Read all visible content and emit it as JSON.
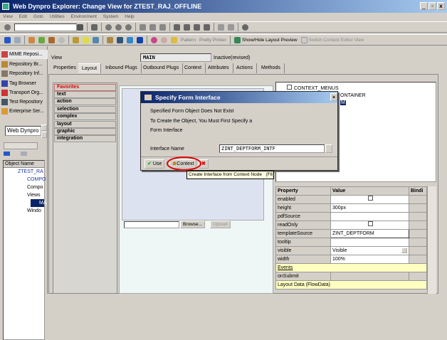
{
  "window": {
    "title": "Web Dynpro Explorer: Change View for ZTEST_RAJ_OFFLINE",
    "min": "_",
    "restore": "▫",
    "close": "x"
  },
  "menu": [
    "View",
    "Edit",
    "Goto",
    "Utilities",
    "Environment",
    "System",
    "Help"
  ],
  "toolbar2": {
    "pattern": "Pattern",
    "pretty_printer": "Pretty Printer",
    "show_hide": "Show/Hide Layout Preview",
    "switch_context": "Switch Context Editor View"
  },
  "nav": {
    "items": [
      "MIME Reposi...",
      "Repository Br...",
      "Repository Inf...",
      "Tag Browser",
      "Transport Org...",
      "Test Repository",
      "Enterprise Ser..."
    ],
    "dropdown": "Web Dynpro",
    "tree_header": "Object Name",
    "tree": [
      "ZTEST_RA",
      "COMPO",
      "Compo",
      "Views",
      "MA",
      "Windo"
    ]
  },
  "view": {
    "label": "View",
    "name": "MAIN",
    "status": "Inactive(revised)"
  },
  "tabs": [
    "Properties",
    "Layout",
    "Inbound Plugs",
    "Outbound Plugs",
    "Context",
    "Attributes",
    "Actions",
    "Methods"
  ],
  "active_tab": "Layout",
  "palette": [
    "Favorites",
    "text",
    "action",
    "selection",
    "complex",
    "layout",
    "graphic",
    "integration"
  ],
  "upload": {
    "browse": "Browse...",
    "upload": "Upload"
  },
  "ui_tree": [
    "CONTEXT_MENUS",
    "ONTAINER",
    "M"
  ],
  "dialog": {
    "title": "Specify Form Interface",
    "line1": "Specified Form Object Does Not Exist",
    "line2": "To Create the Object, You Must First Specify a",
    "line3": "Form Interface",
    "field_label": "Interface Name",
    "field_value": "ZINT_DEPTFORM_INTF",
    "use": "Use",
    "context": "Context",
    "highlight_color": "#e00000"
  },
  "tooltip": "Create Interface from Context Node   (F6)",
  "properties": {
    "headers": [
      "Property",
      "Value",
      "Bindi"
    ],
    "rows": [
      {
        "name": "enabled",
        "value": "",
        "checkbox": true
      },
      {
        "name": "height",
        "value": "300px"
      },
      {
        "name": "pdfSource",
        "value": ""
      },
      {
        "name": "readOnly",
        "value": "",
        "checkbox": true
      },
      {
        "name": "templateSource",
        "value": "ZINT_DEPTFORM"
      },
      {
        "name": "tooltip",
        "value": ""
      },
      {
        "name": "visible",
        "value": "Visible",
        "dropdown": true
      },
      {
        "name": "width",
        "value": "100%"
      }
    ],
    "events_label": "Events",
    "event_rows": [
      {
        "name": "onSubmit"
      }
    ],
    "layout_data": "Layout Data (FlowData)"
  }
}
